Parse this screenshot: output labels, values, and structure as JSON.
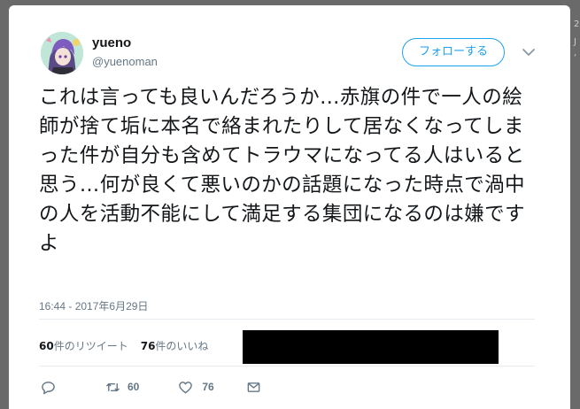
{
  "side_text": [
    "2",
    "J",
    "‘"
  ],
  "user": {
    "name": "yueno",
    "handle": "@yuenoman",
    "avatar_icon": "avatar-illustration"
  },
  "follow_button": {
    "label": "フォローする"
  },
  "menu_icon": "chevron-down-icon",
  "tweet": {
    "text": "これは言っても良いんだろうか…赤旗の件で一人の絵師が捨て垢に本名で絡まれたりして居なくなってしまった件が自分も含めてトラウマになってる人はいると思う…何が良くて悪いのかの話題になった時点で渦中の人を活動不能にして満足する集団になるのは嫌ですよ",
    "timestamp": "16:44 - 2017年6月29日"
  },
  "stats": {
    "retweets_count": "60",
    "retweets_label": "件のリツイート",
    "likes_count": "76",
    "likes_label": "件のいいね"
  },
  "actions": {
    "reply_icon": "reply-icon",
    "retweet_icon": "retweet-icon",
    "retweet_count": "60",
    "like_icon": "heart-icon",
    "like_count": "76",
    "dm_icon": "envelope-icon"
  },
  "colors": {
    "accent": "#1da1f2",
    "muted": "#657786",
    "text": "#14171a",
    "backdrop": "#6a6a6a"
  }
}
